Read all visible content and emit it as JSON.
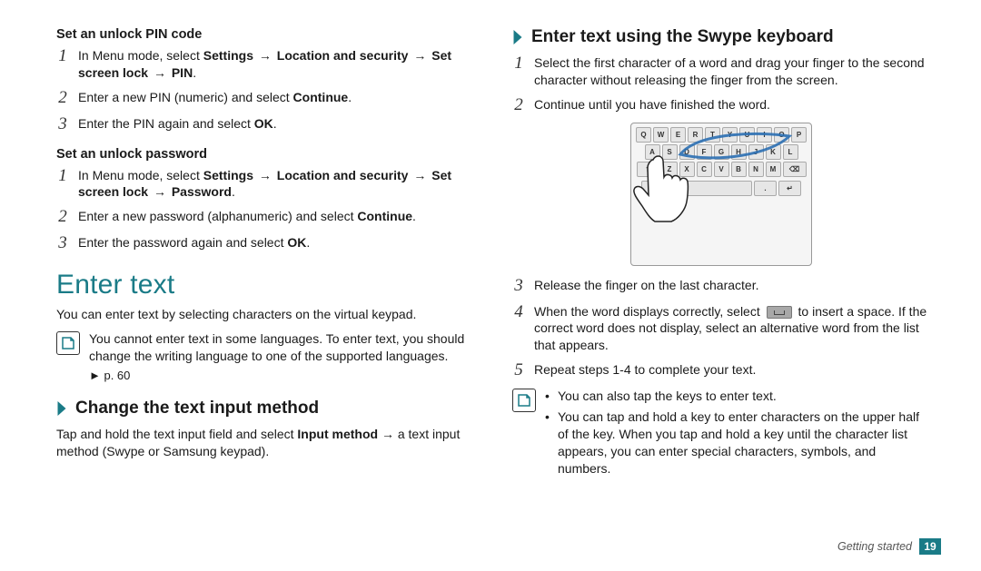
{
  "left": {
    "pin_heading": "Set an unlock PIN code",
    "pin_steps": {
      "s1_pre": "In Menu mode, select ",
      "s1_b1": "Settings",
      "s1_b2": "Location and security",
      "s1_b3": "Set screen lock",
      "s1_b4": "PIN",
      "s2_pre": "Enter a new PIN (numeric) and select ",
      "s2_b": "Continue",
      "s3_pre": "Enter the PIN again and select ",
      "s3_b": "OK"
    },
    "pw_heading": "Set an unlock password",
    "pw_steps": {
      "s1_pre": "In Menu mode, select ",
      "s1_b1": "Settings",
      "s1_b2": "Location and security",
      "s1_b3": "Set screen lock",
      "s1_b4": "Password",
      "s2_pre": "Enter a new password (alphanumeric) and select ",
      "s2_b": "Continue",
      "s3_pre": "Enter the password again and select ",
      "s3_b": "OK"
    },
    "enter_text_heading": "Enter text",
    "enter_text_intro": "You can enter text by selecting characters on the virtual keypad.",
    "note_text": "You cannot enter text in some languages. To enter text, you should change the writing language to one of the supported languages.",
    "note_ref": "► p. 60",
    "change_input_heading": "Change the text input method",
    "change_input_pre": "Tap and hold the text input field and select ",
    "change_input_b": "Input method",
    "change_input_post": " → a text input method (Swype or Samsung keypad)."
  },
  "right": {
    "swype_heading": "Enter text using the Swype keyboard",
    "s1": "Select the first character of a word and drag your finger to the second character without releasing the finger from the screen.",
    "s2": "Continue until you have finished the word.",
    "s3": "Release the finger on the last character.",
    "s4_pre": "When the word displays correctly, select ",
    "s4_post": " to insert a space. If the correct word does not display, select an alternative word from the list that appears.",
    "s5": "Repeat steps 1-4 to complete your text.",
    "bullet1": "You can also tap the keys to enter text.",
    "bullet2": "You can tap and hold a key to enter characters on the upper half of the key. When you tap and hold a key until the character list appears, you can enter special characters, symbols, and numbers.",
    "kb": {
      "r1": [
        "Q",
        "W",
        "E",
        "R",
        "T",
        "Y",
        "U",
        "I",
        "O",
        "P"
      ],
      "r2": [
        "A",
        "S",
        "D",
        "F",
        "G",
        "H",
        "J",
        "K",
        "L"
      ],
      "r3": [
        "Z",
        "X",
        "C",
        "V",
        "B",
        "N",
        "M"
      ]
    }
  },
  "footer": {
    "section": "Getting started",
    "page": "19"
  },
  "arrow": "→",
  "dot": "."
}
